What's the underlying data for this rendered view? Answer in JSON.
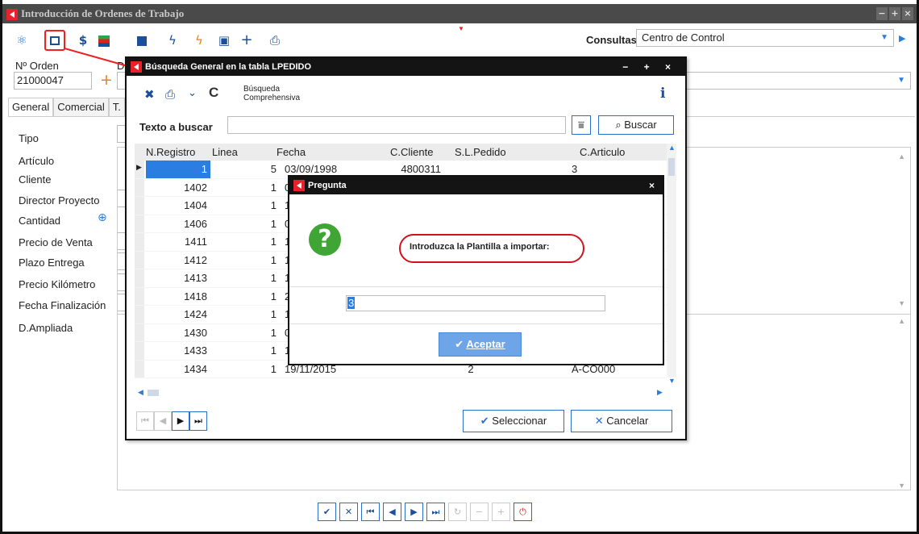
{
  "window": {
    "title": "Introducción de Ordenes de Trabajo",
    "controls": [
      "−",
      "+",
      "×"
    ]
  },
  "toolbar": {
    "icons": [
      "atom-icon",
      "import-icon",
      "dollar-icon",
      "grid-icon",
      "stack-icon",
      "bolt-icon",
      "bolt-orange-icon",
      "doc-search-icon",
      "plus-icon",
      "print-icon"
    ],
    "consultas_label": "Consultas",
    "consultas_value": "Centro de Control"
  },
  "order": {
    "label": "Nº Orden",
    "value": "21000047",
    "second_label": "D"
  },
  "tabs": [
    "General",
    "Comercial",
    "T."
  ],
  "fields": [
    "Tipo",
    "Artículo",
    "Cliente",
    "Director Proyecto",
    "Cantidad",
    "Precio de Venta",
    "Plazo Entrega",
    "Precio Kilómetro",
    "Fecha Finalización",
    "D.Ampliada"
  ],
  "search_dialog": {
    "title": "Búsqueda General en la tabla LPEDIDO",
    "controls": "− + ×",
    "comprehensive_label_1": "Búsqueda",
    "comprehensive_label_2": "Comprehensiva",
    "search_label": "Texto a buscar",
    "search_value": "",
    "search_button": "Buscar",
    "columns": [
      "N.Registro",
      "Linea",
      "Fecha",
      "C.Cliente",
      "S.L.Pedido",
      "C.Articulo"
    ],
    "rows": [
      [
        "1",
        "5",
        "03/09/1998",
        "4800311",
        "",
        "3"
      ],
      [
        "1402",
        "1",
        "05",
        "",
        "",
        ""
      ],
      [
        "1404",
        "1",
        "19",
        "",
        "",
        ""
      ],
      [
        "1406",
        "1",
        "08",
        "",
        "",
        ""
      ],
      [
        "1411",
        "1",
        "12",
        "",
        "",
        ""
      ],
      [
        "1412",
        "1",
        "12",
        "",
        "",
        ""
      ],
      [
        "1413",
        "1",
        "12",
        "",
        "",
        ""
      ],
      [
        "1418",
        "1",
        "21",
        "",
        "",
        ""
      ],
      [
        "1424",
        "1",
        "10",
        "",
        "",
        ""
      ],
      [
        "1430",
        "1",
        "07",
        "",
        "",
        ""
      ],
      [
        "1433",
        "1",
        "14",
        "",
        "",
        ""
      ],
      [
        "1434",
        "1",
        "19/11/2015",
        "",
        "2",
        "A-CO000"
      ]
    ],
    "select_button": "Seleccionar",
    "cancel_button": "Cancelar"
  },
  "question_dialog": {
    "title": "Pregunta",
    "close": "×",
    "prompt": "Introduzca la Plantilla a importar:",
    "input_value": "3",
    "accept_button": "Aceptar"
  },
  "colors": {
    "accent": "#2a7de1",
    "brand": "#e8212b",
    "highlight": "#d0141e",
    "question": "#3fa535"
  }
}
